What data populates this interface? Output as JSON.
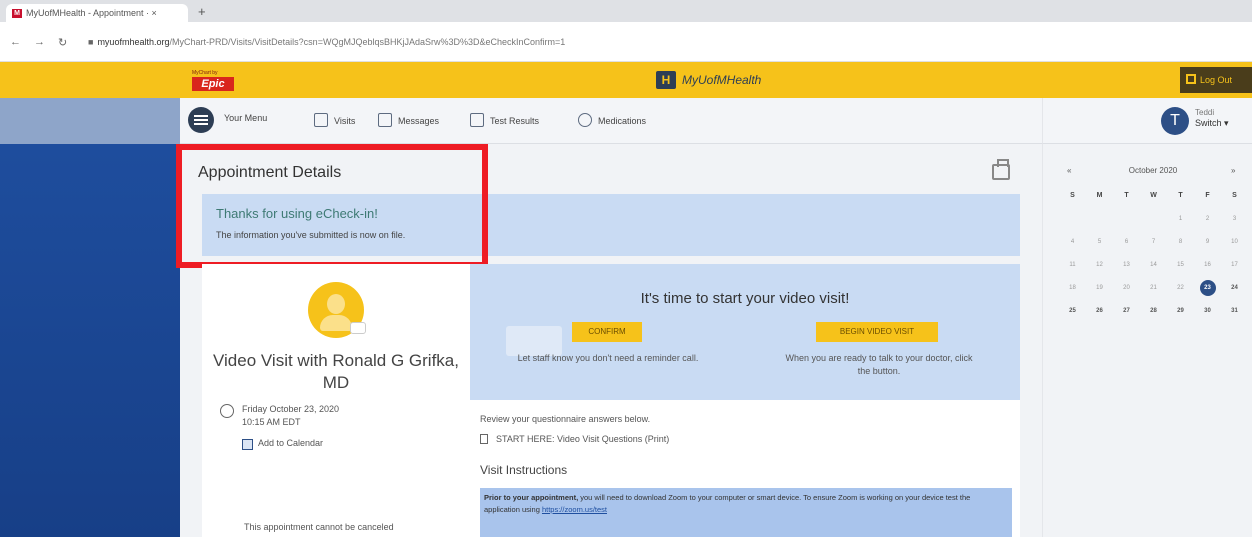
{
  "browser": {
    "tab_title": "MyUofMHealth - Appointment · ×",
    "tab_close": "×",
    "new_tab": "+",
    "url_domain": "myuofmhealth.org",
    "url_path": "/MyChart-PRD/Visits/VisitDetails?csn=WQgMJQeblqsBHKjJAdaSrw%3D%3D&eCheckInConfirm=1",
    "back": "←",
    "forward": "→",
    "reload": "↻"
  },
  "header": {
    "epic_tagline": "MyChart by",
    "epic_word": "Epic",
    "brand_logo": "H",
    "brand_name": "MyUofMHealth",
    "logout_label": "Log Out"
  },
  "menu": {
    "your_menu": "Your Menu",
    "visits": "Visits",
    "messages": "Messages",
    "test_results": "Test Results",
    "medications": "Medications"
  },
  "user": {
    "initial": "T",
    "name": "Teddi",
    "switch_label": "Switch ▾"
  },
  "page": {
    "title": "Appointment Details",
    "checkin_title": "Thanks for using eCheck-in!",
    "checkin_body": "The information you've submitted is now on file."
  },
  "visit": {
    "title": "Video Visit with Ronald G Grifka, MD",
    "date_line1": "Friday October 23, 2020",
    "date_line2": "10:15 AM EDT",
    "add_to_calendar": "Add to Calendar",
    "cancel_note": "This appointment cannot be canceled"
  },
  "video": {
    "heading": "It's time to start your video visit!",
    "confirm_label": "CONFIRM",
    "confirm_text": "Let staff know you don't need a reminder call.",
    "begin_label": "BEGIN VIDEO VISIT",
    "begin_text_1": "When you are ready to talk to your doctor, click",
    "begin_text_2": "the button."
  },
  "review": {
    "line1": "Review your questionnaire answers below.",
    "line2": "START HERE: Video Visit Questions (Print)",
    "instructions_heading": "Visit Instructions",
    "instr_bold": "Prior to your appointment,",
    "instr_text": " you will need to download Zoom to your computer or smart device. To ensure Zoom is working on your device test the application using ",
    "instr_link": "https://zoom.us/test"
  },
  "calendar": {
    "prev": "«",
    "next": "»",
    "month": "October 2020",
    "dow": [
      "S",
      "M",
      "T",
      "W",
      "T",
      "F",
      "S"
    ],
    "weeks": [
      [
        "",
        "",
        "",
        "",
        "1",
        "2",
        "3"
      ],
      [
        "4",
        "5",
        "6",
        "7",
        "8",
        "9",
        "10"
      ],
      [
        "11",
        "12",
        "13",
        "14",
        "15",
        "16",
        "17"
      ],
      [
        "18",
        "19",
        "20",
        "21",
        "22",
        "23",
        "24"
      ],
      [
        "25",
        "26",
        "27",
        "28",
        "29",
        "30",
        "31"
      ]
    ],
    "selected": "23"
  },
  "colors": {
    "header_yellow": "#f6c21a",
    "nav_blue": "#1f4fa0",
    "panel_blue": "#c9dbf3",
    "highlight_red": "#ee1c24"
  },
  "icons": {
    "menu": "hamburger-icon",
    "visits": "calendar-icon",
    "messages": "envelope-icon",
    "test_results": "flask-icon",
    "medications": "pill-icon",
    "print": "printer-icon",
    "logout": "logout-icon"
  }
}
